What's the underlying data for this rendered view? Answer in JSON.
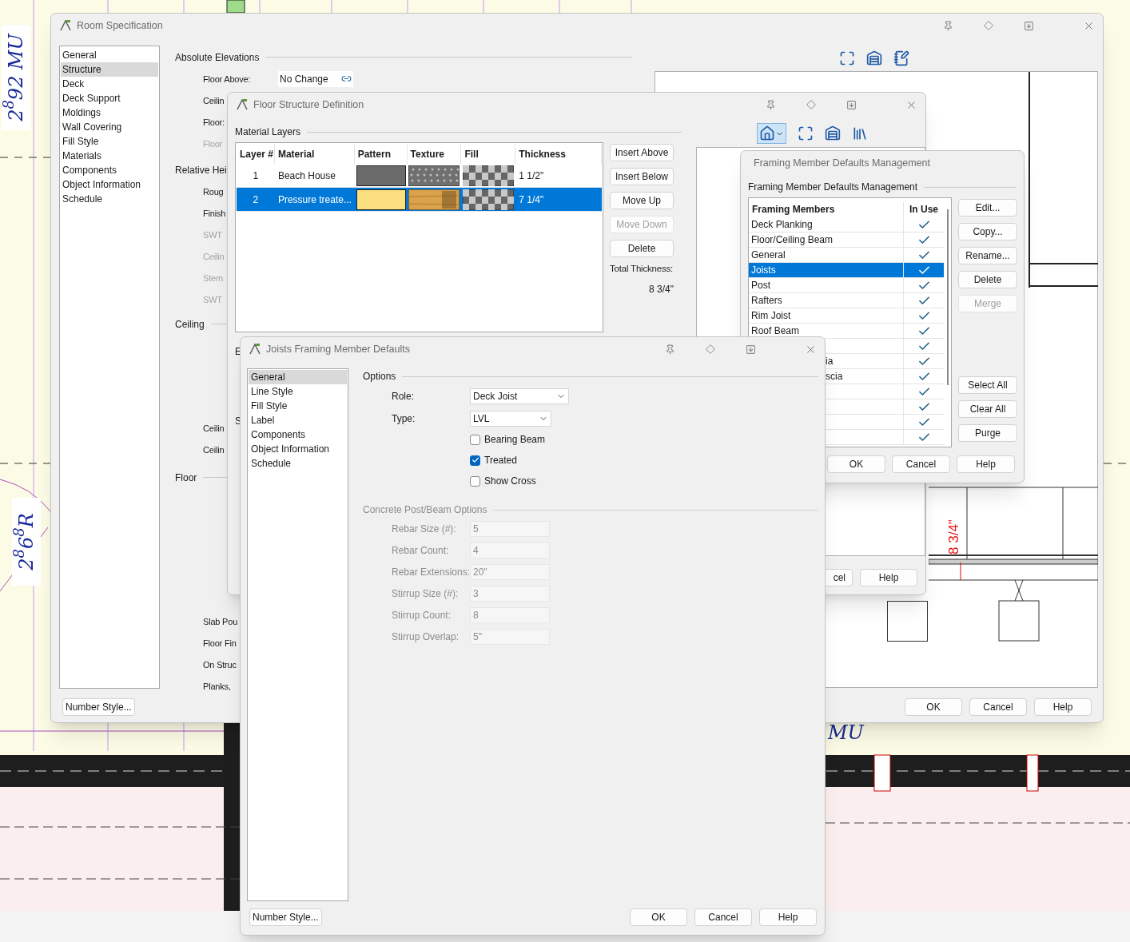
{
  "canvas": {
    "notes": [
      {
        "text": "2$^{8}$92 MU"
      },
      {
        "text": "2$^{8}$6$^{8}$R"
      },
      {
        "text": "MU"
      }
    ]
  },
  "room_specification": {
    "title": "Room Specification",
    "nav": [
      {
        "label": "General",
        "selected": false
      },
      {
        "label": "Structure",
        "selected": true
      },
      {
        "label": "Deck",
        "selected": false
      },
      {
        "label": "Deck Support",
        "selected": false
      },
      {
        "label": "Moldings",
        "selected": false
      },
      {
        "label": "Wall Covering",
        "selected": false
      },
      {
        "label": "Fill Style",
        "selected": false
      },
      {
        "label": "Materials",
        "selected": false
      },
      {
        "label": "Components",
        "selected": false
      },
      {
        "label": "Object Information",
        "selected": false
      },
      {
        "label": "Schedule",
        "selected": false
      }
    ],
    "fields": [
      {
        "kind": "section",
        "label": "Absolute Elevations"
      },
      {
        "kind": "row",
        "label": "Floor Above:",
        "value": "No Change",
        "disabled": false
      },
      {
        "kind": "row",
        "label": "Ceilin",
        "disabled": false
      },
      {
        "kind": "row",
        "label": "Floor:",
        "disabled": false
      },
      {
        "kind": "row",
        "label": "Floor",
        "disabled": true
      },
      {
        "kind": "section",
        "label": "Relative Hei"
      },
      {
        "kind": "row",
        "label": "Roug",
        "disabled": false
      },
      {
        "kind": "row",
        "label": "Finish",
        "disabled": false
      },
      {
        "kind": "row",
        "label": "SWT",
        "disabled": true
      },
      {
        "kind": "row",
        "label": "Ceilin",
        "disabled": true
      },
      {
        "kind": "row",
        "label": "Stem",
        "disabled": true
      },
      {
        "kind": "row",
        "label": "SWT",
        "disabled": true
      },
      {
        "kind": "section",
        "label": "Ceiling"
      },
      {
        "kind": "row",
        "label": "Ceilin",
        "disabled": false
      },
      {
        "kind": "row",
        "label": "Ceilin",
        "disabled": false
      },
      {
        "kind": "section",
        "label": "Floor"
      },
      {
        "kind": "row",
        "label": "Slab Pou",
        "disabled": false
      },
      {
        "kind": "row",
        "label": "Floor Fin",
        "disabled": false
      },
      {
        "kind": "row",
        "label": "On Struc",
        "disabled": false
      },
      {
        "kind": "row",
        "label": "Planks,",
        "disabled": false
      }
    ],
    "preview": {
      "dimension": "8 3/4\""
    },
    "number_style_button": "Number Style...",
    "buttons": [
      "OK",
      "Cancel",
      "Help"
    ]
  },
  "floor_structure": {
    "title": "Floor Structure Definition",
    "section": "Material Layers",
    "columns": [
      "Layer #",
      "Material",
      "Pattern",
      "Texture",
      "Fill",
      "Thickness"
    ],
    "layers": [
      {
        "number": "1",
        "material": "Beach House",
        "pattern": {
          "color": "#6b6b6b"
        },
        "texture": {
          "kind": "gravel"
        },
        "thickness": "1 1/2\"",
        "selected": false
      },
      {
        "number": "2",
        "material": "Pressure treate...",
        "pattern": {
          "color": "#fce07f"
        },
        "texture": {
          "kind": "wood"
        },
        "thickness": "7 1/4\"",
        "selected": true
      }
    ],
    "buttons": [
      {
        "label": "Insert Above",
        "disabled": false
      },
      {
        "label": "Insert Below",
        "disabled": false
      },
      {
        "label": "Move Up",
        "disabled": false
      },
      {
        "label": "Move Down",
        "disabled": true
      },
      {
        "label": "Delete",
        "disabled": false
      }
    ],
    "total_label": "Total Thickness:",
    "total": "8 3/4\"",
    "hidden_labels": [
      "E",
      "S"
    ],
    "bottom_buttons": [
      "cel",
      "Help"
    ]
  },
  "framing_management": {
    "title": "Framing Member Defaults Management",
    "section": "Framing Member Defaults Management",
    "columns": [
      "Framing Members",
      "In Use"
    ],
    "members": [
      {
        "kind": "full",
        "name": "Deck Planking",
        "in_use": true,
        "selected": false
      },
      {
        "kind": "full",
        "name": "Floor/Ceiling Beam",
        "in_use": true,
        "selected": false
      },
      {
        "kind": "full",
        "name": "General",
        "in_use": true,
        "selected": false
      },
      {
        "kind": "full",
        "name": "Joists",
        "in_use": true,
        "selected": true
      },
      {
        "kind": "full",
        "name": "Post",
        "in_use": true,
        "selected": false
      },
      {
        "kind": "full",
        "name": "Rafters",
        "in_use": true,
        "selected": false
      },
      {
        "kind": "full",
        "name": "Rim Joist",
        "in_use": true,
        "selected": false
      },
      {
        "kind": "full",
        "name": "Roof Beam",
        "in_use": true,
        "selected": false
      },
      {
        "kind": "full",
        "in_use": true,
        "selected": false
      },
      {
        "kind": "cut",
        "name": "ia",
        "in_use": true,
        "selected": false
      },
      {
        "kind": "cut",
        "name": "scia",
        "in_use": true,
        "selected": false
      },
      {
        "kind": "full",
        "in_use": true,
        "selected": false
      },
      {
        "kind": "full",
        "in_use": true,
        "selected": false
      },
      {
        "kind": "full",
        "in_use": true,
        "selected": false
      },
      {
        "kind": "full",
        "in_use": true,
        "selected": false
      }
    ],
    "buttons": [
      {
        "label": "Edit...",
        "disabled": false
      },
      {
        "label": "Copy...",
        "disabled": false
      },
      {
        "label": "Rename...",
        "disabled": false
      },
      {
        "label": "Delete",
        "disabled": false
      },
      {
        "label": "Merge",
        "disabled": true
      }
    ],
    "list_buttons": [
      "Select All",
      "Clear All",
      "Purge"
    ],
    "bottom_buttons": [
      "OK",
      "Cancel",
      "Help"
    ]
  },
  "joists_defaults": {
    "title": "Joists Framing Member Defaults",
    "nav": [
      {
        "label": "General",
        "selected": true
      },
      {
        "label": "Line Style",
        "selected": false
      },
      {
        "label": "Fill Style",
        "selected": false
      },
      {
        "label": "Label",
        "selected": false
      },
      {
        "label": "Components",
        "selected": false
      },
      {
        "label": "Object Information",
        "selected": false
      },
      {
        "label": "Schedule",
        "selected": false
      }
    ],
    "options_title": "Options",
    "role": {
      "label": "Role:",
      "value": "Deck Joist"
    },
    "type": {
      "label": "Type:",
      "value": "LVL"
    },
    "checkboxes": [
      {
        "label": "Bearing Beam",
        "checked": false
      },
      {
        "label": "Treated",
        "checked": true
      },
      {
        "label": "Show Cross",
        "checked": false
      }
    ],
    "concrete_title": "Concrete Post/Beam Options",
    "concrete": [
      {
        "label": "Rebar Size (#):",
        "value": "5",
        "disabled": true
      },
      {
        "label": "Rebar Count:",
        "value": "4",
        "disabled": true
      },
      {
        "label": "Rebar Extensions:",
        "value": "20\"",
        "disabled": true
      },
      {
        "label": "Stirrup Size (#):",
        "value": "3",
        "disabled": true
      },
      {
        "label": "Stirrup Count:",
        "value": "8",
        "disabled": true
      },
      {
        "label": "Stirrup Overlap:",
        "value": "5\"",
        "disabled": true
      }
    ],
    "number_style_button": "Number Style...",
    "buttons": [
      "OK",
      "Cancel",
      "Help"
    ]
  }
}
